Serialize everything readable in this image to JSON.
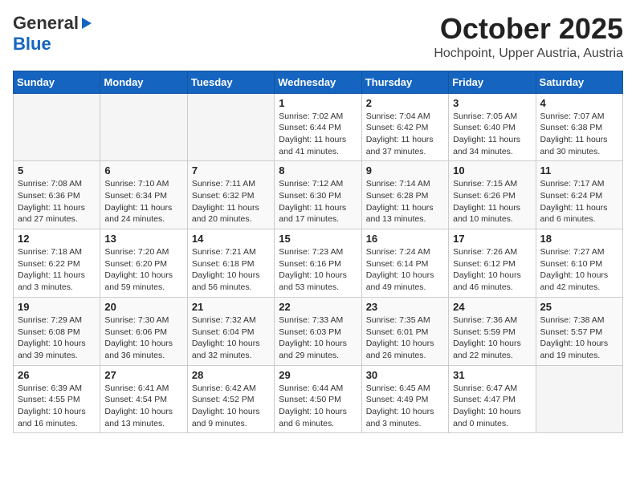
{
  "header": {
    "logo_line1": "General",
    "logo_line2": "Blue",
    "title": "October 2025",
    "subtitle": "Hochpoint, Upper Austria, Austria"
  },
  "weekdays": [
    "Sunday",
    "Monday",
    "Tuesday",
    "Wednesday",
    "Thursday",
    "Friday",
    "Saturday"
  ],
  "weeks": [
    [
      {
        "day": "",
        "info": ""
      },
      {
        "day": "",
        "info": ""
      },
      {
        "day": "",
        "info": ""
      },
      {
        "day": "1",
        "info": "Sunrise: 7:02 AM\nSunset: 6:44 PM\nDaylight: 11 hours\nand 41 minutes."
      },
      {
        "day": "2",
        "info": "Sunrise: 7:04 AM\nSunset: 6:42 PM\nDaylight: 11 hours\nand 37 minutes."
      },
      {
        "day": "3",
        "info": "Sunrise: 7:05 AM\nSunset: 6:40 PM\nDaylight: 11 hours\nand 34 minutes."
      },
      {
        "day": "4",
        "info": "Sunrise: 7:07 AM\nSunset: 6:38 PM\nDaylight: 11 hours\nand 30 minutes."
      }
    ],
    [
      {
        "day": "5",
        "info": "Sunrise: 7:08 AM\nSunset: 6:36 PM\nDaylight: 11 hours\nand 27 minutes."
      },
      {
        "day": "6",
        "info": "Sunrise: 7:10 AM\nSunset: 6:34 PM\nDaylight: 11 hours\nand 24 minutes."
      },
      {
        "day": "7",
        "info": "Sunrise: 7:11 AM\nSunset: 6:32 PM\nDaylight: 11 hours\nand 20 minutes."
      },
      {
        "day": "8",
        "info": "Sunrise: 7:12 AM\nSunset: 6:30 PM\nDaylight: 11 hours\nand 17 minutes."
      },
      {
        "day": "9",
        "info": "Sunrise: 7:14 AM\nSunset: 6:28 PM\nDaylight: 11 hours\nand 13 minutes."
      },
      {
        "day": "10",
        "info": "Sunrise: 7:15 AM\nSunset: 6:26 PM\nDaylight: 11 hours\nand 10 minutes."
      },
      {
        "day": "11",
        "info": "Sunrise: 7:17 AM\nSunset: 6:24 PM\nDaylight: 11 hours\nand 6 minutes."
      }
    ],
    [
      {
        "day": "12",
        "info": "Sunrise: 7:18 AM\nSunset: 6:22 PM\nDaylight: 11 hours\nand 3 minutes."
      },
      {
        "day": "13",
        "info": "Sunrise: 7:20 AM\nSunset: 6:20 PM\nDaylight: 10 hours\nand 59 minutes."
      },
      {
        "day": "14",
        "info": "Sunrise: 7:21 AM\nSunset: 6:18 PM\nDaylight: 10 hours\nand 56 minutes."
      },
      {
        "day": "15",
        "info": "Sunrise: 7:23 AM\nSunset: 6:16 PM\nDaylight: 10 hours\nand 53 minutes."
      },
      {
        "day": "16",
        "info": "Sunrise: 7:24 AM\nSunset: 6:14 PM\nDaylight: 10 hours\nand 49 minutes."
      },
      {
        "day": "17",
        "info": "Sunrise: 7:26 AM\nSunset: 6:12 PM\nDaylight: 10 hours\nand 46 minutes."
      },
      {
        "day": "18",
        "info": "Sunrise: 7:27 AM\nSunset: 6:10 PM\nDaylight: 10 hours\nand 42 minutes."
      }
    ],
    [
      {
        "day": "19",
        "info": "Sunrise: 7:29 AM\nSunset: 6:08 PM\nDaylight: 10 hours\nand 39 minutes."
      },
      {
        "day": "20",
        "info": "Sunrise: 7:30 AM\nSunset: 6:06 PM\nDaylight: 10 hours\nand 36 minutes."
      },
      {
        "day": "21",
        "info": "Sunrise: 7:32 AM\nSunset: 6:04 PM\nDaylight: 10 hours\nand 32 minutes."
      },
      {
        "day": "22",
        "info": "Sunrise: 7:33 AM\nSunset: 6:03 PM\nDaylight: 10 hours\nand 29 minutes."
      },
      {
        "day": "23",
        "info": "Sunrise: 7:35 AM\nSunset: 6:01 PM\nDaylight: 10 hours\nand 26 minutes."
      },
      {
        "day": "24",
        "info": "Sunrise: 7:36 AM\nSunset: 5:59 PM\nDaylight: 10 hours\nand 22 minutes."
      },
      {
        "day": "25",
        "info": "Sunrise: 7:38 AM\nSunset: 5:57 PM\nDaylight: 10 hours\nand 19 minutes."
      }
    ],
    [
      {
        "day": "26",
        "info": "Sunrise: 6:39 AM\nSunset: 4:55 PM\nDaylight: 10 hours\nand 16 minutes."
      },
      {
        "day": "27",
        "info": "Sunrise: 6:41 AM\nSunset: 4:54 PM\nDaylight: 10 hours\nand 13 minutes."
      },
      {
        "day": "28",
        "info": "Sunrise: 6:42 AM\nSunset: 4:52 PM\nDaylight: 10 hours\nand 9 minutes."
      },
      {
        "day": "29",
        "info": "Sunrise: 6:44 AM\nSunset: 4:50 PM\nDaylight: 10 hours\nand 6 minutes."
      },
      {
        "day": "30",
        "info": "Sunrise: 6:45 AM\nSunset: 4:49 PM\nDaylight: 10 hours\nand 3 minutes."
      },
      {
        "day": "31",
        "info": "Sunrise: 6:47 AM\nSunset: 4:47 PM\nDaylight: 10 hours\nand 0 minutes."
      },
      {
        "day": "",
        "info": ""
      }
    ]
  ]
}
